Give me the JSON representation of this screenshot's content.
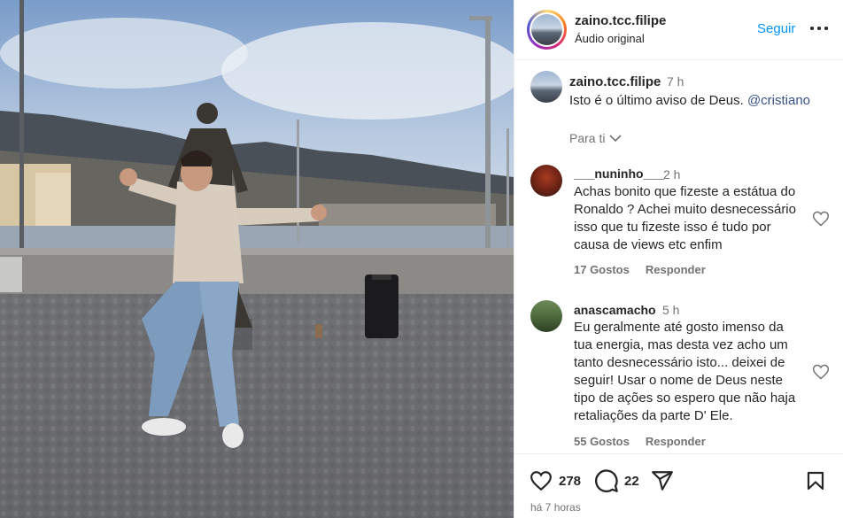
{
  "post": {
    "author": "zaino.tcc.filipe",
    "audio": "Áudio original",
    "follow_label": "Seguir"
  },
  "caption": {
    "user": "zaino.tcc.filipe",
    "time": "7 h",
    "text": "Isto é o último aviso de Deus. ",
    "mention": "@cristiano"
  },
  "sort_label": "Para ti",
  "comments": [
    {
      "user": "___nuninho___",
      "time": "2 h",
      "lines": [
        "Achas bonito que fizeste a estátua do",
        "Ronaldo ? Achei muito desnecessário",
        "isso que tu fizeste isso é tudo por",
        "causa de views etc enfim"
      ],
      "likes": "17 Gostos",
      "reply": "Responder"
    },
    {
      "user": "anascamacho",
      "time": "5 h",
      "lines": [
        "Eu geralmente até gosto imenso da",
        "tua energia, mas desta vez acho um",
        "tanto desnecessário isto... deixei de",
        "seguir! Usar o nome de Deus neste",
        "tipo de ações so espero que não haja",
        "retaliações da parte D' Ele."
      ],
      "likes": "55 Gostos",
      "reply": "Responder"
    }
  ],
  "actions": {
    "like_count": "278",
    "comment_count": "22",
    "posted": "há 7 horas"
  },
  "icons": {
    "like": "heart-icon",
    "comment": "comment-icon",
    "share": "share-icon",
    "save": "bookmark-icon",
    "more": "more-icon",
    "sort": "chevron-down-icon"
  },
  "colors": {
    "link": "#0095f6",
    "mention": "#385185",
    "muted": "#737373",
    "text": "#262626"
  }
}
